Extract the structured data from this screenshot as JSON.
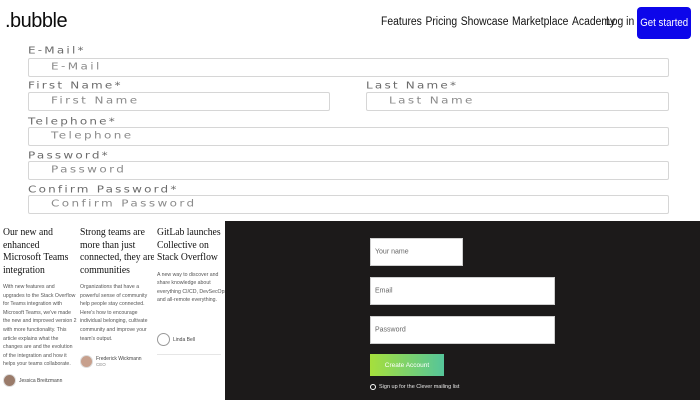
{
  "header": {
    "logo": ".bubble",
    "nav": [
      "Features",
      "Pricing",
      "Showcase",
      "Marketplace",
      "Academy"
    ],
    "login": "Log in",
    "get_started": "Get started",
    "accent_color": "#0d06ea"
  },
  "form": {
    "email": {
      "label": "E-Mail*",
      "placeholder": "E-Mail"
    },
    "first_name": {
      "label": "First Name*",
      "placeholder": "First Name"
    },
    "last_name": {
      "label": "Last Name*",
      "placeholder": "Last Name"
    },
    "telephone": {
      "label": "Telephone*",
      "placeholder": "Telephone"
    },
    "password": {
      "label": "Password*",
      "placeholder": "Password"
    },
    "confirm_password": {
      "label": "Confirm Password*",
      "placeholder": "Confirm Password"
    }
  },
  "news": [
    {
      "title": "Our new and enhanced Microsoft Teams integration",
      "body": "With new features and upgrades to the Stack Overflow for Teams integration with Microsoft Teams, we've made the new and improved version 2 with more functionality. This article explains what the changes are and the evolution of the integration and how it helps your teams collaborate.",
      "author": "Jessica Breitzmann"
    },
    {
      "title": "Strong teams are more than just connected, they are communities",
      "body": "Organizations that have a powerful sense of community help people stay connected. Here's how to encourage individual belonging, cultivate community and improve your team's output.",
      "author": "Frederick Wickmann",
      "author_sub": "CEO"
    },
    {
      "title": "GitLab launches Collective on Stack Overflow",
      "body": "A new way to discover and share knowledge about everything CI/CD, DevSecOps, and all-remote everything.",
      "author": "Linda Bell"
    }
  ],
  "dark_panel": {
    "your_name_placeholder": "Your name",
    "email_placeholder": "Email",
    "password_placeholder": "Password",
    "create_account": "Create Account",
    "mailing_list": "Sign up for the Clever mailing list",
    "button_gradient": [
      "#a6df3c",
      "#55c59a"
    ]
  }
}
